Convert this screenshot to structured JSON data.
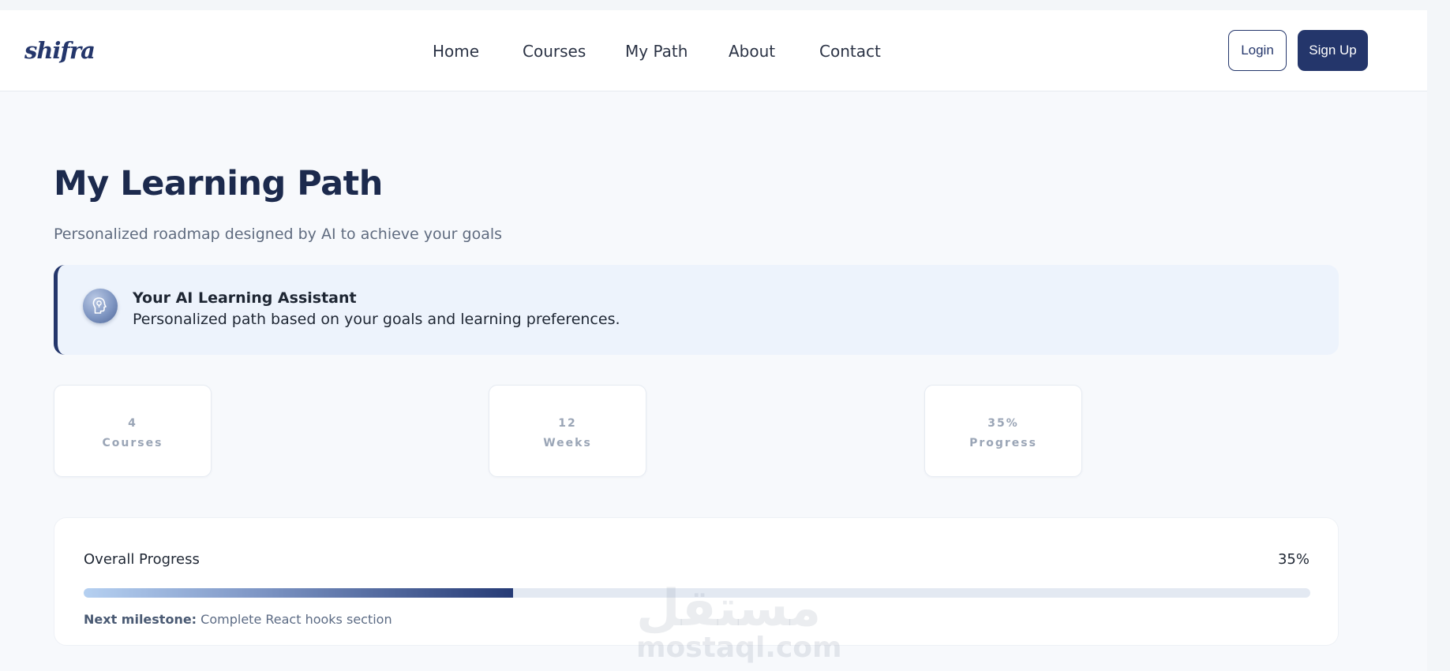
{
  "header": {
    "logo": "shifra",
    "nav": [
      {
        "label": "Home"
      },
      {
        "label": "Courses"
      },
      {
        "label": "My Path"
      },
      {
        "label": "About"
      },
      {
        "label": "Contact"
      }
    ],
    "login_label": "Login",
    "signup_label": "Sign Up"
  },
  "main": {
    "title": "My Learning Path",
    "subtitle": "Personalized roadmap designed by AI to achieve your goals",
    "assistant": {
      "icon": "ai-head-icon",
      "title": "Your AI Learning Assistant",
      "text": "Personalized path based on your goals and learning preferences."
    },
    "stats": [
      {
        "value": "4",
        "label": "Courses"
      },
      {
        "value": "12",
        "label": "Weeks"
      },
      {
        "value": "35%",
        "label": "Progress"
      }
    ],
    "progress": {
      "title": "Overall Progress",
      "percent_label": "35%",
      "value": 0.35,
      "milestone_label": "Next milestone:",
      "milestone_text": "Complete React hooks section"
    }
  },
  "watermark": {
    "arabic": "مستقل",
    "latin": "mostaql.com"
  },
  "colors": {
    "brand": "#24366b",
    "page_bg": "#f7f9fc",
    "assistant_bg": "#edf3fc",
    "progress_track": "#e3e9f2"
  }
}
